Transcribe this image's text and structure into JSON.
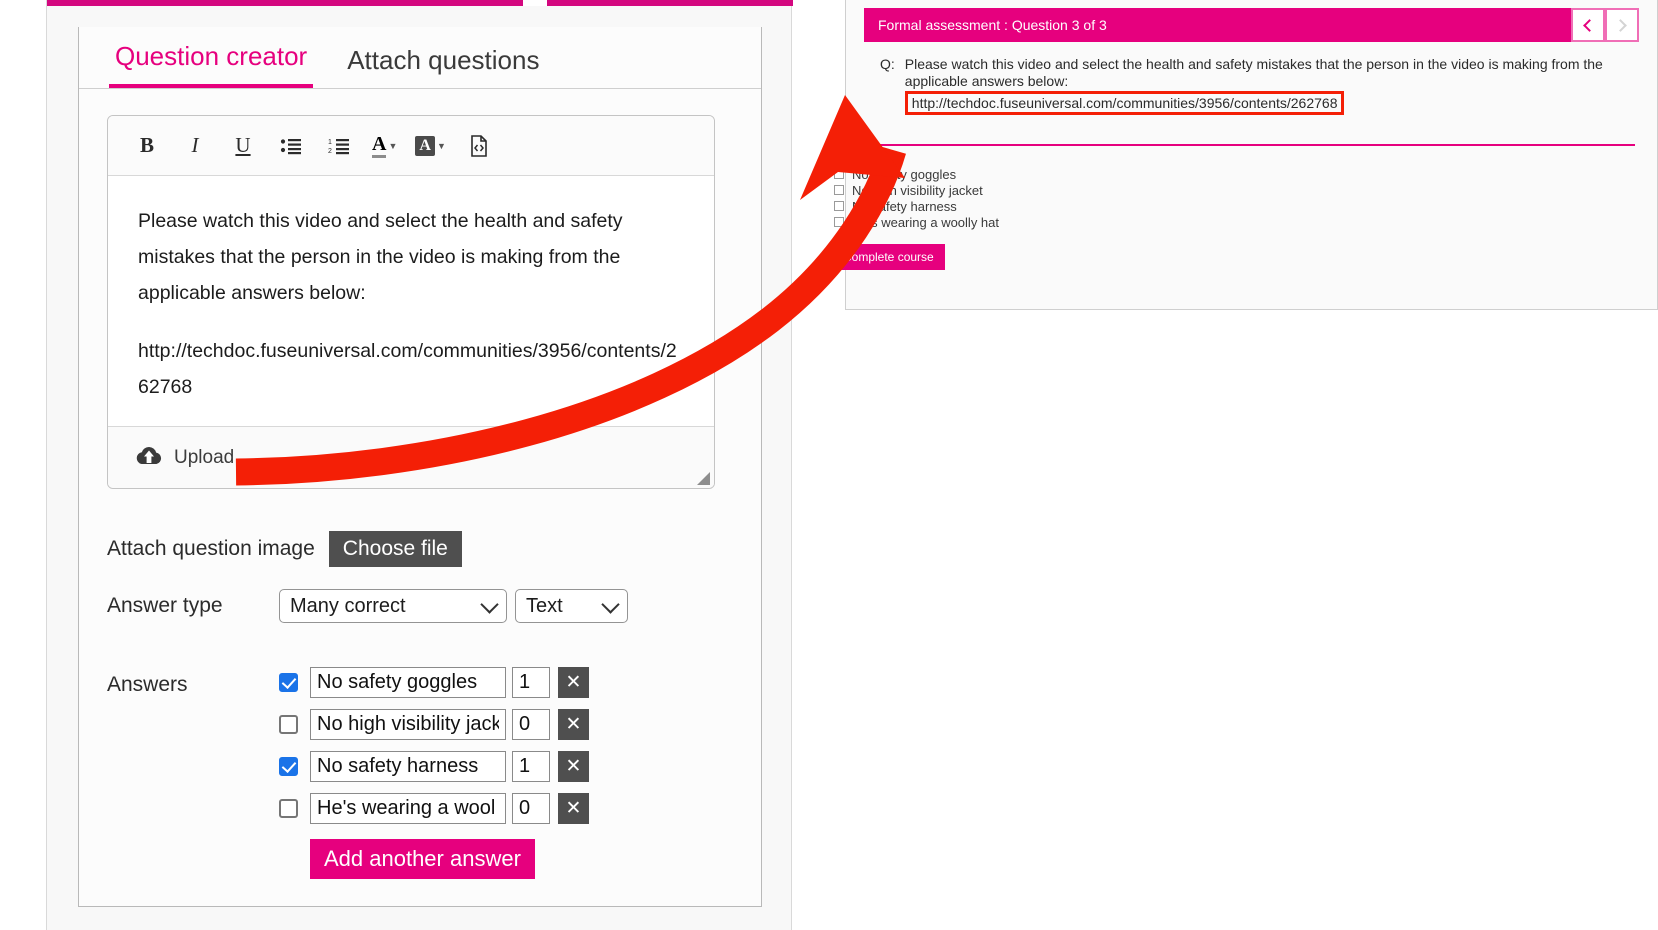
{
  "colors": {
    "accent_pink": "#e6007e",
    "header_pink": "#d3077f",
    "annotation_red": "#f41f06",
    "checkbox_blue": "#1a73e8",
    "dark_button": "#4f4f4f"
  },
  "creator": {
    "tabs": [
      {
        "label": "Question creator",
        "active": true
      },
      {
        "label": "Attach questions",
        "active": false
      }
    ],
    "toolbar": [
      {
        "name": "bold-icon",
        "glyph": "B"
      },
      {
        "name": "italic-icon",
        "glyph": "I"
      },
      {
        "name": "underline-icon",
        "glyph": "U"
      },
      {
        "name": "bulleted-list-icon",
        "glyph": ""
      },
      {
        "name": "numbered-list-icon",
        "glyph": ""
      },
      {
        "name": "font-color-icon",
        "glyph": "A"
      },
      {
        "name": "highlight-color-icon",
        "glyph": "A"
      },
      {
        "name": "source-code-icon",
        "glyph": ""
      }
    ],
    "editor": {
      "paragraph_1": "Please watch this video and select the health and safety mistakes that the person in the video is making from the applicable answers below:",
      "paragraph_2": "http://techdoc.fuseuniversal.com/communities/3956/contents/262768"
    },
    "upload_label": "Upload",
    "attach_image": {
      "label": "Attach question image",
      "button_label": "Choose file"
    },
    "answer_type": {
      "label": "Answer type",
      "selected_type": "Many correct",
      "selected_format": "Text"
    },
    "answers": {
      "label": "Answers",
      "rows": [
        {
          "checked": true,
          "text": "No safety goggles",
          "score": "1",
          "delete_label": "✕"
        },
        {
          "checked": false,
          "text": "No high visibility jack",
          "score": "0",
          "delete_label": "✕"
        },
        {
          "checked": true,
          "text": "No safety harness",
          "score": "1",
          "delete_label": "✕"
        },
        {
          "checked": false,
          "text": "He's wearing a wool",
          "score": "0",
          "delete_label": "✕"
        }
      ],
      "add_button_label": "Add another answer"
    }
  },
  "preview": {
    "header_title": "Formal assessment : Question 3 of 3",
    "nav": {
      "prev_label": "‹",
      "next_label": "›"
    },
    "question_marker": "Q:",
    "question_text": "Please watch this video and select the health and safety mistakes that the person in the video is making from the applicable answers below:",
    "question_url": "http://techdoc.fuseuniversal.com/communities/3956/contents/262768",
    "answers": [
      "No safety goggles",
      "No high visibility jacket",
      "No safety harness",
      "He's wearing a woolly hat"
    ],
    "complete_button_label": "Complete course"
  }
}
